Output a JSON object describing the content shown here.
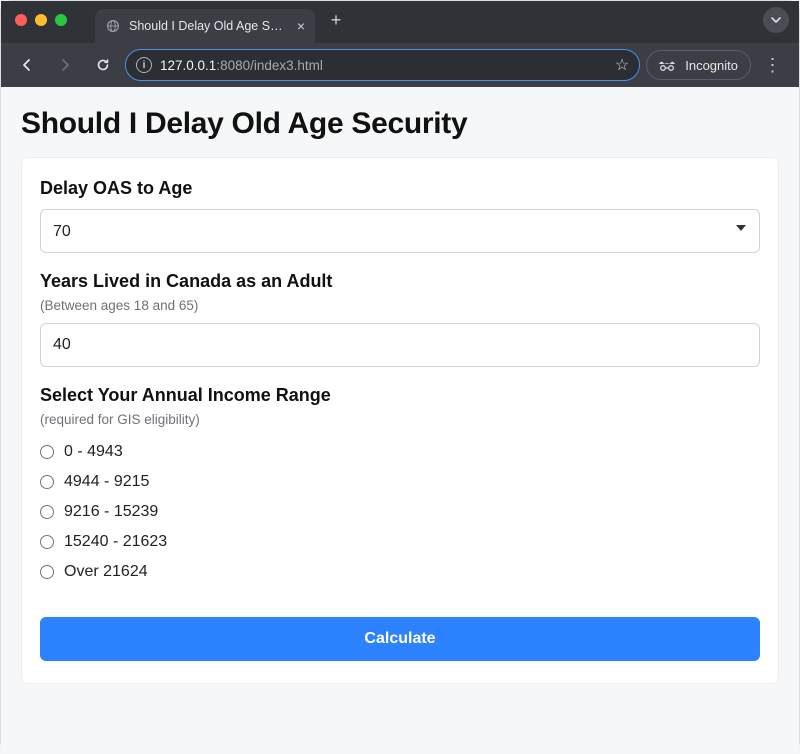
{
  "browser": {
    "tab_title": "Should I Delay Old Age Secur",
    "url_host": "127.0.0.1",
    "url_port_path": ":8080/index3.html",
    "incognito_label": "Incognito"
  },
  "page": {
    "title": "Should I Delay Old Age Security"
  },
  "form": {
    "delay": {
      "label": "Delay OAS to Age",
      "value": "70"
    },
    "years_canada": {
      "label": "Years Lived in Canada as an Adult",
      "sublabel": "(Between ages 18 and 65)",
      "value": "40"
    },
    "income": {
      "label": "Select Your Annual Income Range",
      "sublabel": "(required for GIS eligibility)",
      "options": [
        "0 - 4943",
        "4944 - 9215",
        "9216 - 15239",
        "15240 - 21623",
        "Over 21624"
      ]
    },
    "submit_label": "Calculate"
  }
}
